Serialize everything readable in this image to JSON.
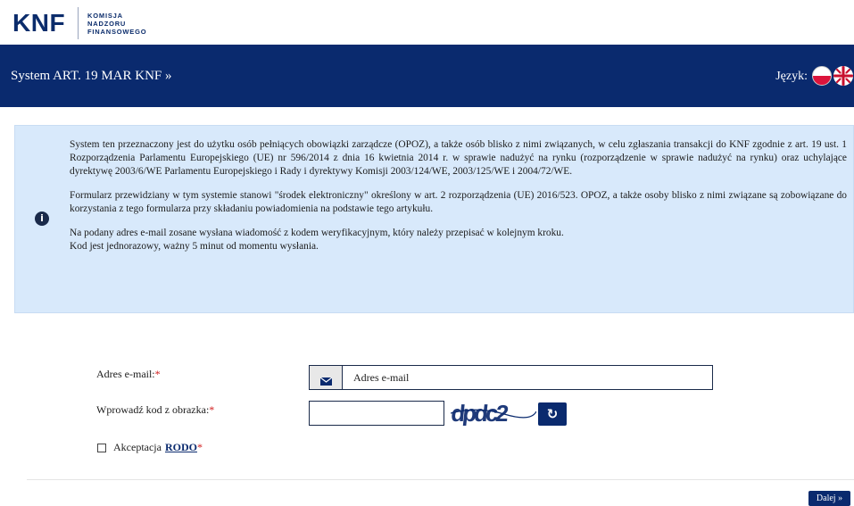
{
  "brand": {
    "logo_mark": "KNF",
    "logo_lines": [
      "KOMISJA",
      "NADZORU",
      "FINANSOWEGO"
    ]
  },
  "header": {
    "app_title": "System ART. 19 MAR KNF »",
    "language_label": "Język:",
    "languages": [
      "polish-flag-icon",
      "uk-flag-icon"
    ]
  },
  "info": {
    "icon": "info-circle-icon",
    "paragraph1": "System ten przeznaczony jest do użytku osób pełniących obowiązki zarządcze (OPOZ), a także osób blisko z nimi związanych, w celu zgłaszania transakcji do KNF zgodnie z art. 19 ust. 1 Rozporządzenia Parlamentu Europejskiego (UE) nr 596/2014 z dnia 16 kwietnia 2014 r. w sprawie nadużyć na rynku (rozporządzenie w sprawie nadużyć na rynku) oraz uchylające dyrektywę 2003/6/WE Parlamentu Europejskiego i Rady i dyrektywy Komisji 2003/124/WE, 2003/125/WE i 2004/72/WE.",
    "paragraph2": "Formularz przewidziany w tym systemie stanowi \"środek elektroniczny\" określony w art. 2 rozporządzenia (UE) 2016/523. OPOZ, a także osoby blisko z nimi związane są zobowiązane do korzystania z tego formularza przy składaniu powiadomienia na podstawie tego artykułu.",
    "paragraph3_line1": "Na podany adres e-mail zosane wysłana wiadomość z kodem weryfikacyjnym, który należy przepisać w kolejnym kroku.",
    "paragraph3_line2": "Kod jest jednorazowy, ważny 5 minut od momentu wysłania."
  },
  "form": {
    "email_label": "Adres e-mail:",
    "email_placeholder": "Adres e-mail",
    "email_value": "",
    "captcha_label": "Wprowadź kod z obrazka:",
    "captcha_value": "",
    "captcha_text": "dpdc2",
    "required_mark": "*",
    "rodo_prefix": "Akceptacja",
    "rodo_link": "RODO",
    "rodo_checked": false
  },
  "actions": {
    "next_label": "Dalej »"
  },
  "colors": {
    "navy": "#0a2a6e",
    "info_bg": "#d8e9fb",
    "required": "#d01818"
  }
}
